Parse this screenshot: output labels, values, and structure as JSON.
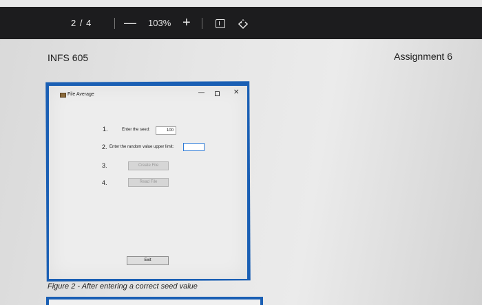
{
  "viewer": {
    "page_indicator": "2 / 4",
    "zoom_out": "—",
    "zoom_level": "103%",
    "zoom_in": "+"
  },
  "document": {
    "header_left": "INFS 605",
    "header_right": "Assignment 6",
    "caption": "Figure 2 - After entering a correct seed value"
  },
  "app_window": {
    "title": "File Average",
    "controls": {
      "minimize": "—",
      "close": "✕"
    },
    "rows": [
      {
        "num": "1.",
        "label": "Enter the seed:",
        "value": "100"
      },
      {
        "num": "2.",
        "label": "Enter the random value upper limit:",
        "value": ""
      },
      {
        "num": "3.",
        "button": "Create File"
      },
      {
        "num": "4.",
        "button": "Read File"
      }
    ],
    "exit_button": "Exit"
  }
}
